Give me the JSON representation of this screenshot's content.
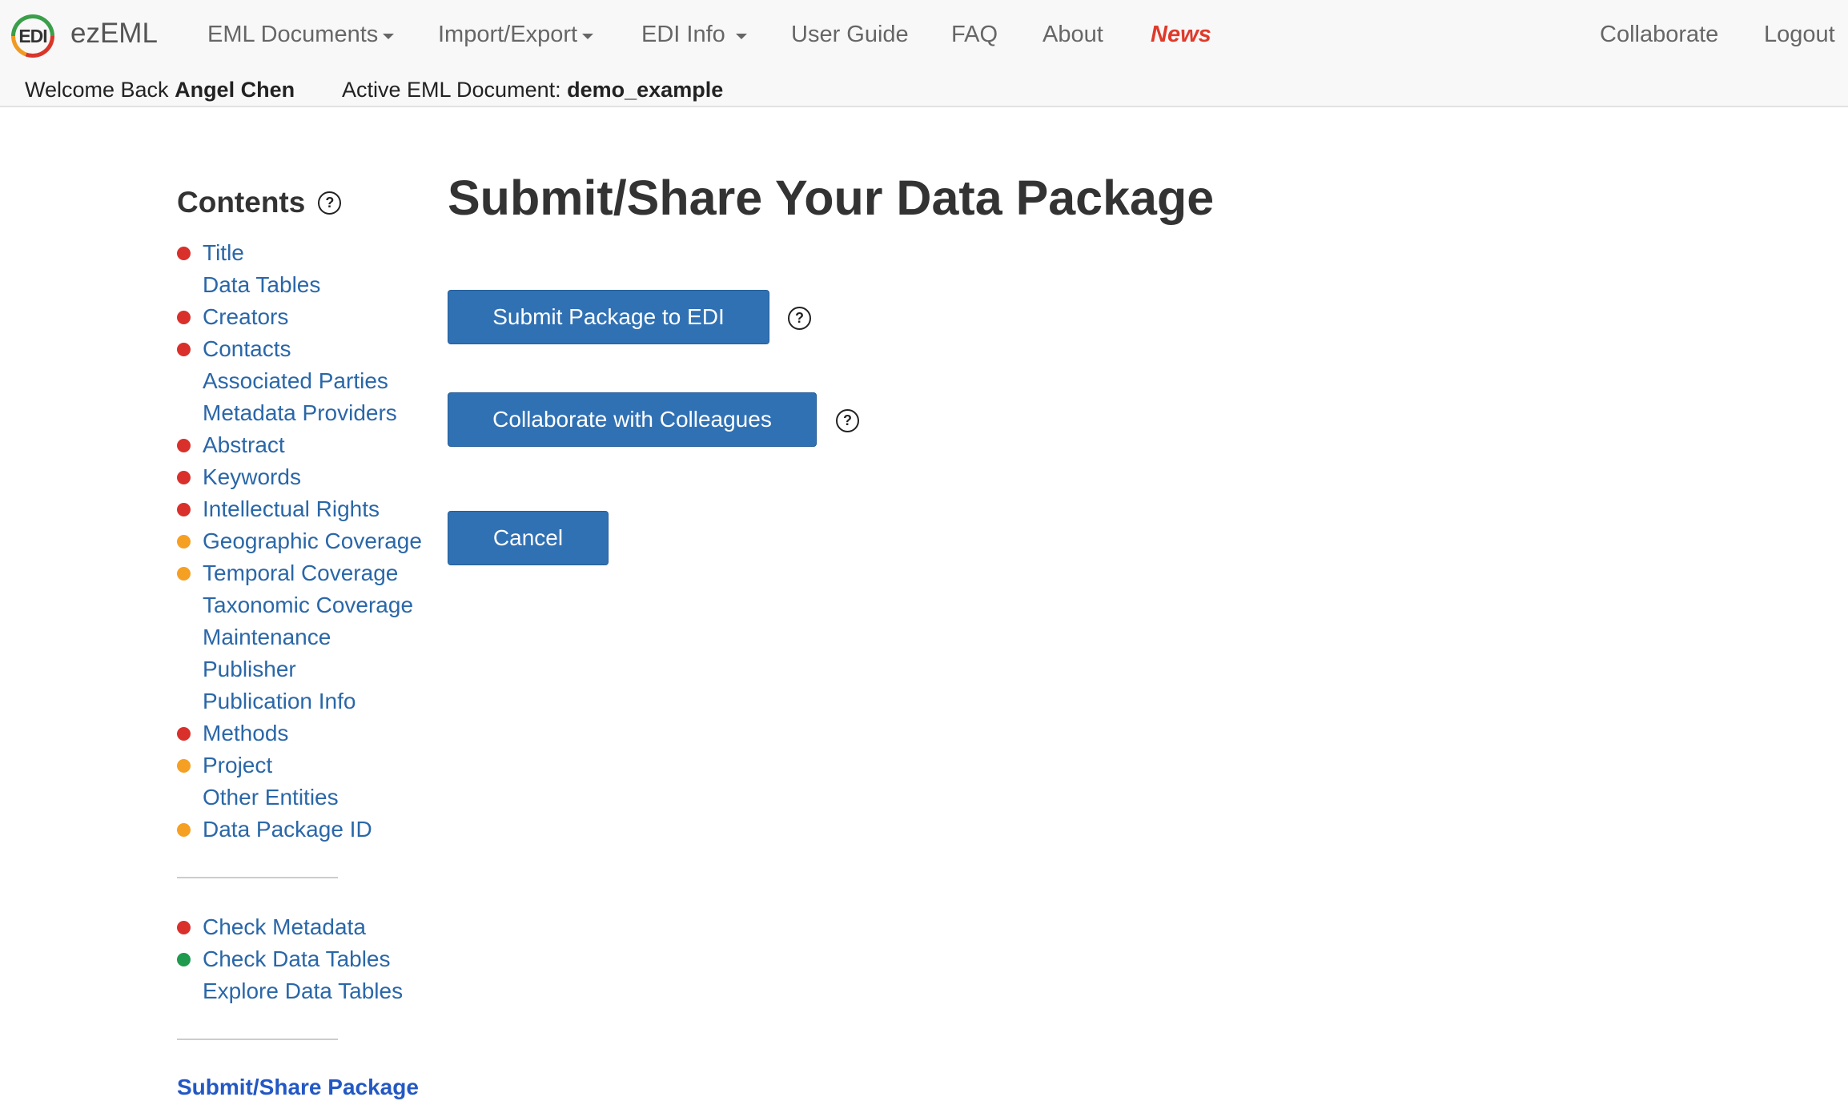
{
  "brand": {
    "logo_text": "EDI",
    "name": "ezEML"
  },
  "nav": {
    "eml_documents": "EML Documents",
    "import_export": "Import/Export",
    "edi_info": "EDI Info",
    "user_guide": "User Guide",
    "faq": "FAQ",
    "about": "About",
    "news": "News",
    "collaborate": "Collaborate",
    "logout": "Logout"
  },
  "status": {
    "welcome_prefix": "Welcome Back",
    "user_name": "Angel Chen",
    "active_doc_prefix": "Active EML Document:",
    "active_doc_name": "demo_example"
  },
  "sidebar": {
    "heading": "Contents",
    "help_glyph": "?",
    "items": [
      {
        "label": "Title",
        "status": "red"
      },
      {
        "label": "Data Tables",
        "status": "none"
      },
      {
        "label": "Creators",
        "status": "red"
      },
      {
        "label": "Contacts",
        "status": "red"
      },
      {
        "label": "Associated Parties",
        "status": "none"
      },
      {
        "label": "Metadata Providers",
        "status": "none"
      },
      {
        "label": "Abstract",
        "status": "red"
      },
      {
        "label": "Keywords",
        "status": "red"
      },
      {
        "label": "Intellectual Rights",
        "status": "red"
      },
      {
        "label": "Geographic Coverage",
        "status": "orange"
      },
      {
        "label": "Temporal Coverage",
        "status": "orange"
      },
      {
        "label": "Taxonomic Coverage",
        "status": "none"
      },
      {
        "label": "Maintenance",
        "status": "none"
      },
      {
        "label": "Publisher",
        "status": "none"
      },
      {
        "label": "Publication Info",
        "status": "none"
      },
      {
        "label": "Methods",
        "status": "red"
      },
      {
        "label": "Project",
        "status": "orange"
      },
      {
        "label": "Other Entities",
        "status": "none"
      },
      {
        "label": "Data Package ID",
        "status": "orange"
      }
    ],
    "check_items": [
      {
        "label": "Check Metadata",
        "status": "red"
      },
      {
        "label": "Check Data Tables",
        "status": "green"
      },
      {
        "label": "Explore Data Tables",
        "status": "none"
      }
    ],
    "active_item": "Submit/Share Package"
  },
  "status_colors": {
    "red": "#d9302c",
    "orange": "#f5a023",
    "green": "#1f9a4e",
    "none": "transparent"
  },
  "main": {
    "title": "Submit/Share Your Data Package",
    "submit_button": "Submit Package to EDI",
    "collaborate_button": "Collaborate with Colleagues",
    "cancel_button": "Cancel",
    "help_glyph": "?"
  }
}
